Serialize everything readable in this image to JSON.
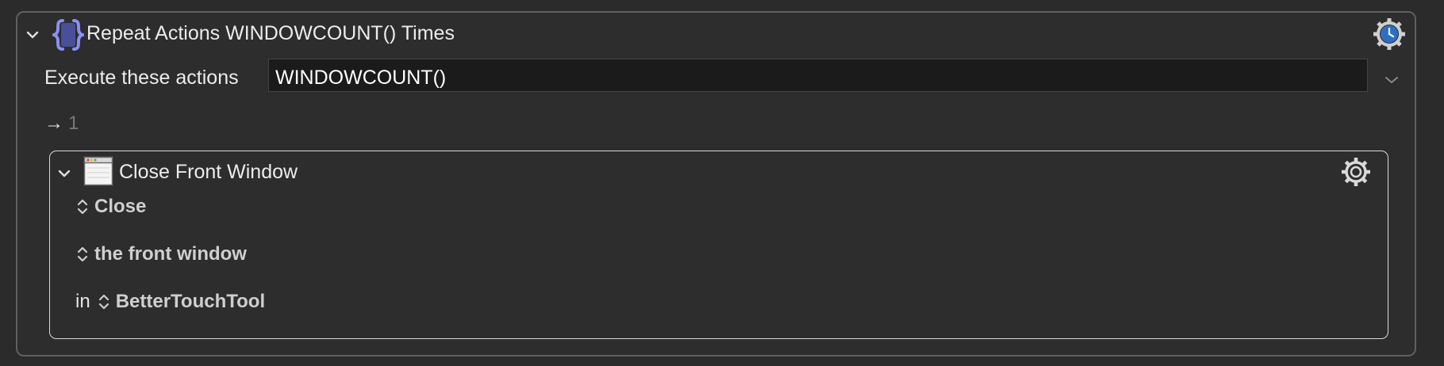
{
  "repeat_action": {
    "title": "Repeat Actions WINDOWCOUNT() Times",
    "execute_label": "Execute these actions",
    "count_value": "WINDOWCOUNT()",
    "arrow_glyph": "→",
    "evaluated_count": "1",
    "icons": [
      "chevron-down-icon",
      "braces-icon",
      "gear-clock-icon",
      "dropdown-chevron-icon"
    ],
    "accent_color": "#7b83f0"
  },
  "close_window_action": {
    "title": "Close Front Window",
    "action_popup": "Close",
    "target_popup": "the front window",
    "in_label": "in",
    "app_popup": "BetterTouchTool",
    "icons": [
      "chevron-down-icon",
      "window-icon",
      "gear-icon",
      "up-down-arrows-icon"
    ]
  }
}
